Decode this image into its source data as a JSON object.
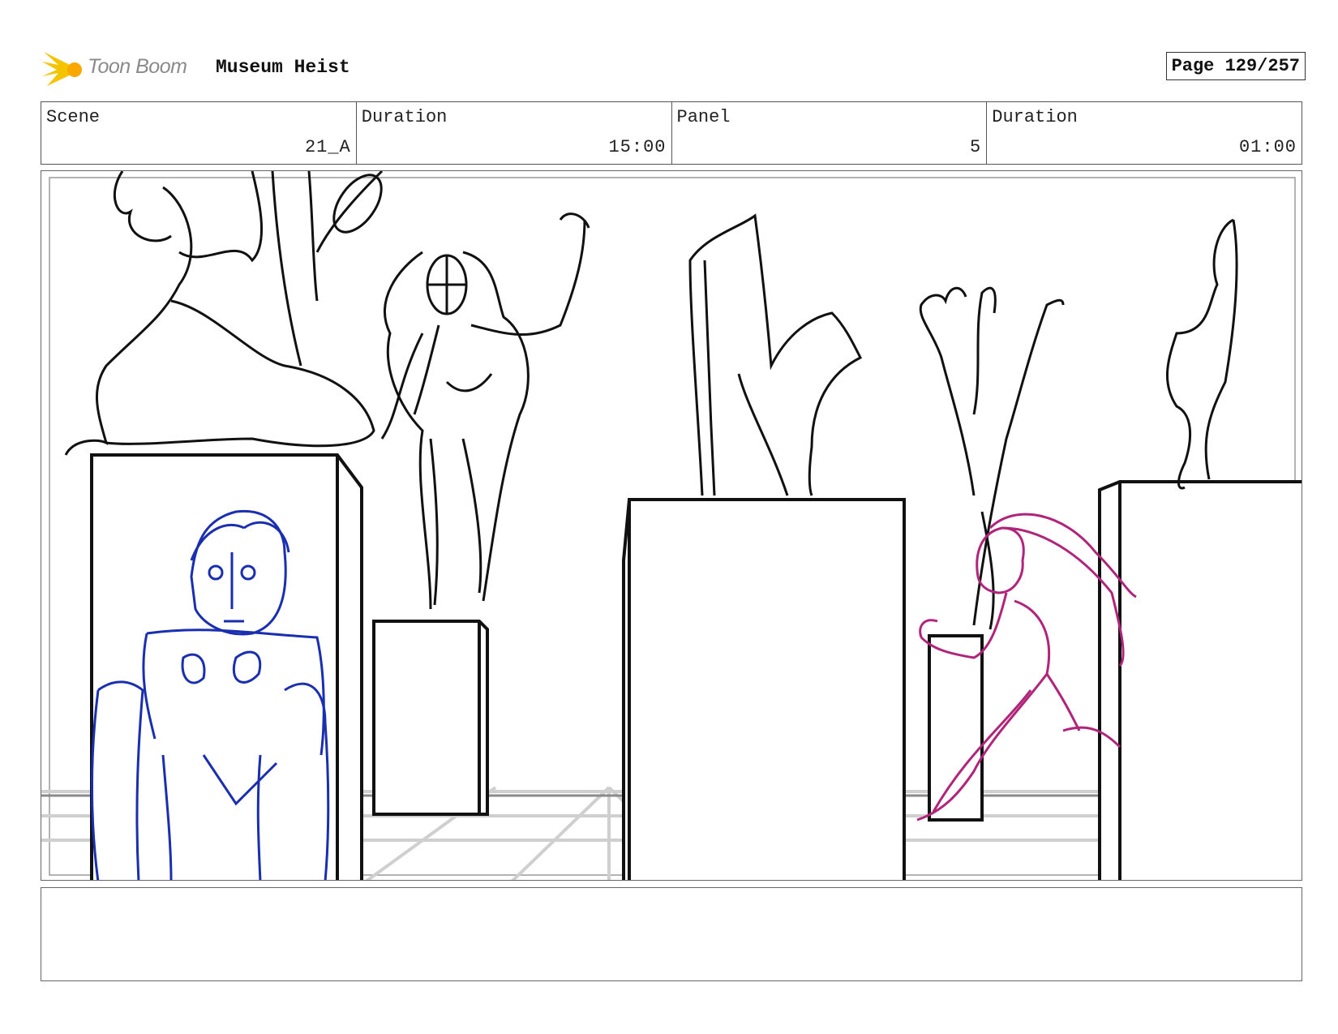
{
  "header": {
    "logo_text": "Toon Boom",
    "project_title": "Museum Heist",
    "page_label": "Page 129/257"
  },
  "info": {
    "scene_label": "Scene",
    "scene_value": "21_A",
    "scene_duration_label": "Duration",
    "scene_duration_value": "15:00",
    "panel_label": "Panel",
    "panel_value": "5",
    "panel_duration_label": "Duration",
    "panel_duration_value": "01:00"
  },
  "colors": {
    "logo_accent": "#f5c400",
    "sketch_black": "#111111",
    "guard_blue": "#1a2fb0",
    "thief_magenta": "#b0247a",
    "floor_grey": "#bdbdbd"
  },
  "notes": {
    "text": ""
  }
}
